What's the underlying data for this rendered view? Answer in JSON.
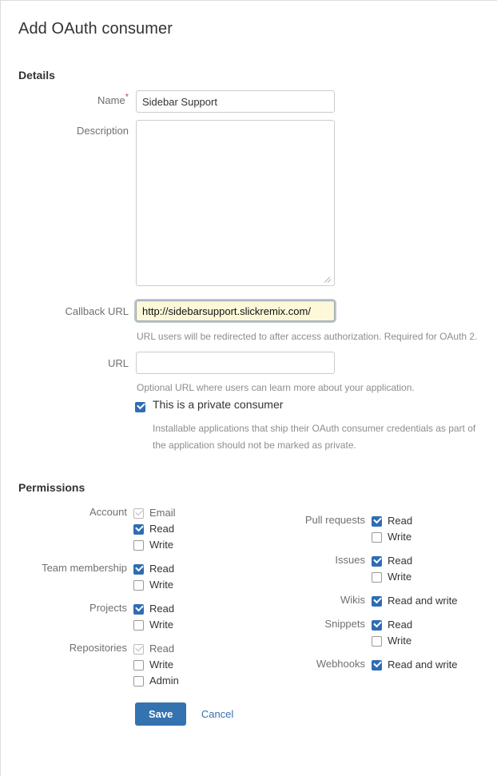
{
  "page": {
    "title": "Add OAuth consumer"
  },
  "details": {
    "heading": "Details",
    "name": {
      "label": "Name",
      "required_marker": "*",
      "value": "Sidebar Support",
      "placeholder": ""
    },
    "description": {
      "label": "Description",
      "value": "",
      "placeholder": ""
    },
    "callback_url": {
      "label": "Callback URL",
      "value": "http://sidebarsupport.slickremix.com/",
      "placeholder": "",
      "help": "URL users will be redirected to after access authorization. Required for OAuth 2."
    },
    "url": {
      "label": "URL",
      "value": "",
      "placeholder": "",
      "help": "Optional URL where users can learn more about your application."
    },
    "private_consumer": {
      "label": "This is a private consumer",
      "checked": true,
      "description": "Installable applications that ship their OAuth consumer credentials as part of the application should not be marked as private."
    }
  },
  "permissions": {
    "heading": "Permissions",
    "left_column": [
      {
        "label": "Account",
        "options": [
          {
            "label": "Email",
            "checked": true,
            "disabled": true
          },
          {
            "label": "Read",
            "checked": true,
            "disabled": false
          },
          {
            "label": "Write",
            "checked": false,
            "disabled": false
          }
        ]
      },
      {
        "label": "Team membership",
        "options": [
          {
            "label": "Read",
            "checked": true,
            "disabled": false
          },
          {
            "label": "Write",
            "checked": false,
            "disabled": false
          }
        ]
      },
      {
        "label": "Projects",
        "options": [
          {
            "label": "Read",
            "checked": true,
            "disabled": false
          },
          {
            "label": "Write",
            "checked": false,
            "disabled": false
          }
        ]
      },
      {
        "label": "Repositories",
        "options": [
          {
            "label": "Read",
            "checked": true,
            "disabled": true
          },
          {
            "label": "Write",
            "checked": false,
            "disabled": false
          },
          {
            "label": "Admin",
            "checked": false,
            "disabled": false
          }
        ]
      }
    ],
    "right_column": [
      {
        "label": "Pull requests",
        "options": [
          {
            "label": "Read",
            "checked": true,
            "disabled": false
          },
          {
            "label": "Write",
            "checked": false,
            "disabled": false
          }
        ]
      },
      {
        "label": "Issues",
        "options": [
          {
            "label": "Read",
            "checked": true,
            "disabled": false
          },
          {
            "label": "Write",
            "checked": false,
            "disabled": false
          }
        ]
      },
      {
        "label": "Wikis",
        "options": [
          {
            "label": "Read and write",
            "checked": true,
            "disabled": false
          }
        ]
      },
      {
        "label": "Snippets",
        "options": [
          {
            "label": "Read",
            "checked": true,
            "disabled": false
          },
          {
            "label": "Write",
            "checked": false,
            "disabled": false
          }
        ]
      },
      {
        "label": "Webhooks",
        "options": [
          {
            "label": "Read and write",
            "checked": true,
            "disabled": false
          }
        ]
      }
    ]
  },
  "actions": {
    "save_label": "Save",
    "cancel_label": "Cancel"
  },
  "colors": {
    "accent": "#3572b0",
    "checkbox_checked": "#2f6db3",
    "required_star": "#d04437",
    "autofill_background": "#fcf8d8",
    "help_text": "#8d8d8d",
    "label_text": "#707070"
  }
}
